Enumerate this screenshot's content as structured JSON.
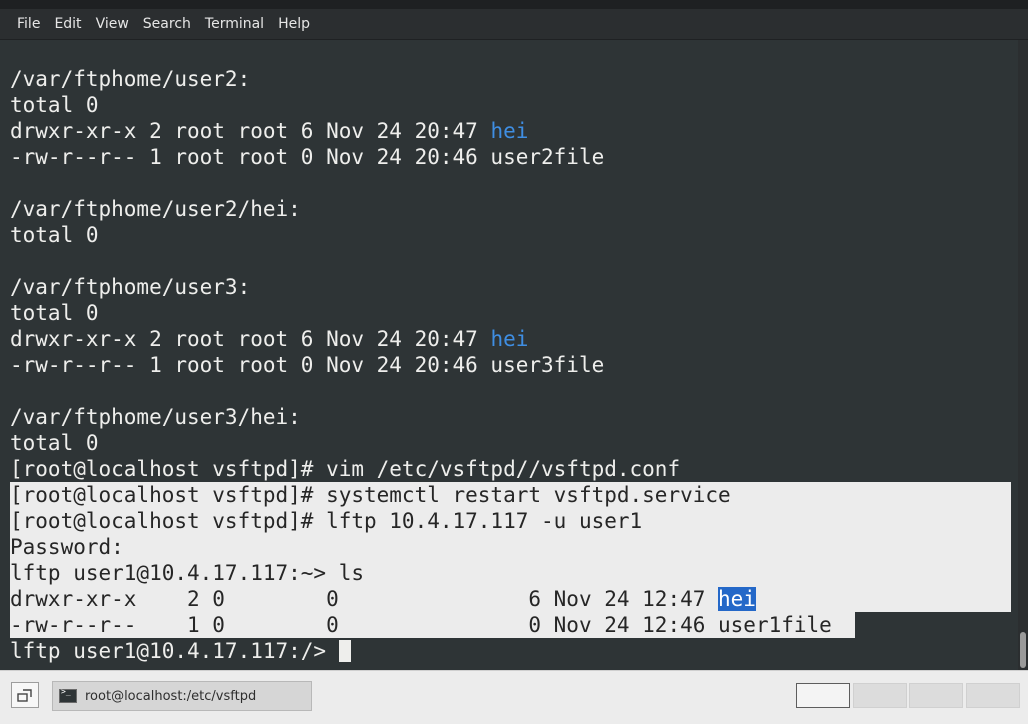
{
  "window": {
    "title": "root@localhost:/etc/vsftpd"
  },
  "menu": {
    "items": [
      "File",
      "Edit",
      "View",
      "Search",
      "Terminal",
      "Help"
    ]
  },
  "terminal": {
    "lines": [
      "",
      "/var/ftphome/user2:",
      "total 0",
      [
        "drwxr-xr-x 2 root root 6 Nov 24 20:47 ",
        "hei"
      ],
      "-rw-r--r-- 1 root root 0 Nov 24 20:46 user2file",
      "",
      "/var/ftphome/user2/hei:",
      "total 0",
      "",
      "/var/ftphome/user3:",
      "total 0",
      [
        "drwxr-xr-x 2 root root 6 Nov 24 20:47 ",
        "hei"
      ],
      "-rw-r--r-- 1 root root 0 Nov 24 20:46 user3file",
      "",
      "/var/ftphome/user3/hei:",
      "total 0",
      "[root@localhost vsftpd]# vim /etc/vsftpd//vsftpd.conf",
      "[root@localhost vsftpd]# systemctl restart vsftpd.service",
      "[root@localhost vsftpd]# lftp 10.4.17.117 -u user1",
      "Password:",
      "lftp user1@10.4.17.117:~> ls",
      [
        "drwxr-xr-x    2 0        0               6 Nov 24 12:47 ",
        "hei"
      ],
      "-rw-r--r--    1 0        0               0 Nov 24 12:46 user1file",
      "lftp user1@10.4.17.117:/> "
    ]
  },
  "taskbar": {
    "task_label": "root@localhost:/etc/vsftpd",
    "workspaces": 4,
    "active_workspace": 1
  },
  "colors": {
    "terminal_bg": "#2e3436",
    "terminal_fg": "#eeeeec",
    "directory": "#3f8ee3",
    "selection_bg": "#ececec",
    "highlight": "#2468c8"
  }
}
